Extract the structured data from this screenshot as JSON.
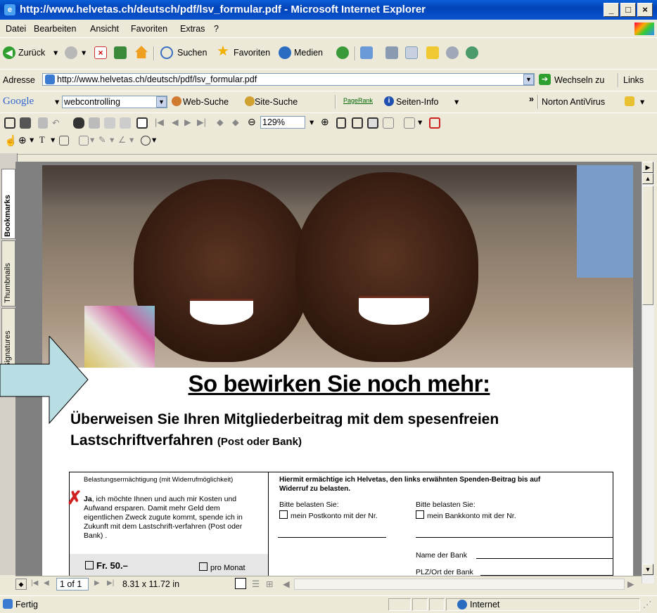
{
  "window": {
    "title": "http://www.helvetas.ch/deutsch/pdf/lsv_formular.pdf - Microsoft Internet Explorer"
  },
  "menu": [
    "Datei",
    "Bearbeiten",
    "Ansicht",
    "Favoriten",
    "Extras",
    "?"
  ],
  "toolbar": {
    "back": "Zurück",
    "search": "Suchen",
    "favorites": "Favoriten",
    "media": "Medien"
  },
  "address": {
    "label": "Adresse",
    "value": "http://www.helvetas.ch/deutsch/pdf/lsv_formular.pdf",
    "go": "Wechseln zu",
    "links": "Links"
  },
  "google": {
    "logo": "Google",
    "query": "webcontrolling",
    "web_search": "Web-Suche",
    "site_search": "Site-Suche",
    "pagerank": "PageRank",
    "page_info": "Seiten-Info",
    "norton": "Norton AntiVirus"
  },
  "acrobat": {
    "zoom": "129%"
  },
  "sidetabs": {
    "bookmarks": "Bookmarks",
    "thumbnails": "Thumbnails",
    "signatures": "Signatures"
  },
  "pdf": {
    "headline": "So bewirken Sie noch mehr:",
    "subheading_line1": "Überweisen Sie Ihren Mitgliederbeitrag mit dem spesenfreien",
    "subheading_line2": "Lastschriftverfahren",
    "subheading_suffix": "(Post oder Bank)",
    "form": {
      "left_caption": "Belastungsermächtigung (mit Widerrufmöglichkeit)",
      "ja": "Ja",
      "ja_text": ", ich möchte Ihnen und auch mir Kosten und Aufwand ersparen. Damit mehr Geld dem eigentlichen Zweck zugute kommt, spende ich in Zukunft mit dem Lastschrift-verfahren (Post oder Bank) .",
      "amount": "Fr. 50.–",
      "per_month": "pro Monat",
      "right_heading": "Hiermit ermächtige ich Helvetas, den links erwähnten Spenden-Beitrag bis auf Widerruf zu belasten.",
      "bitte1": "Bitte belasten Sie:",
      "postkonto": "mein Postkonto mit der Nr.",
      "bitte2": "Bitte belasten Sie:",
      "bankkonto": "mein Bankkonto mit der Nr.",
      "bank_name": "Name der Bank",
      "plz": "PLZ/Ort der Bank"
    }
  },
  "nav": {
    "page": "1 of 1",
    "size": "8.31 x 11.72 in"
  },
  "status": {
    "text": "Fertig",
    "zone": "Internet"
  }
}
